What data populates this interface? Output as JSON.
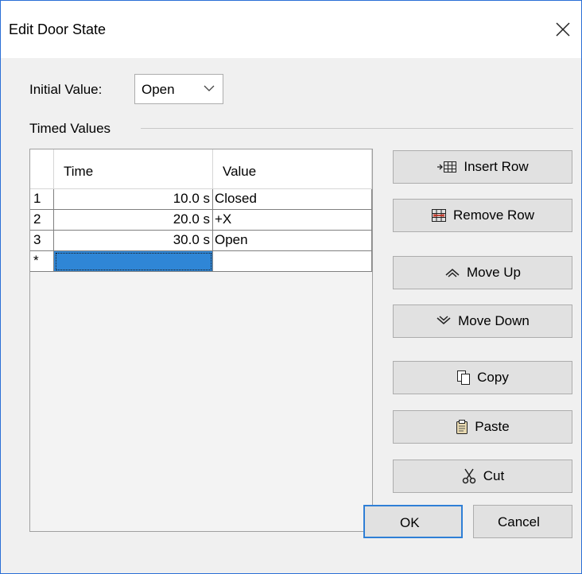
{
  "dialog": {
    "title": "Edit Door State",
    "close_icon": "close-icon"
  },
  "initial_value": {
    "label": "Initial Value:",
    "selected": "Open",
    "dropdown_icon": "chevron-down-icon"
  },
  "timed_values": {
    "group_label": "Timed Values",
    "columns": {
      "time": "Time",
      "value": "Value"
    },
    "rows": [
      {
        "num": "1",
        "time": "10.0 s",
        "value": "Closed"
      },
      {
        "num": "2",
        "time": "20.0 s",
        "value": "+X"
      },
      {
        "num": "3",
        "time": "30.0 s",
        "value": "Open"
      },
      {
        "num": "*",
        "time": "",
        "value": ""
      }
    ],
    "selection_color": "#2f86d6"
  },
  "buttons": {
    "insert_row": "Insert Row",
    "remove_row": "Remove Row",
    "move_up": "Move Up",
    "move_down": "Move Down",
    "copy": "Copy",
    "paste": "Paste",
    "cut": "Cut",
    "ok": "OK",
    "cancel": "Cancel"
  },
  "icons": [
    "insert-row-icon",
    "remove-row-icon",
    "move-up-icon",
    "move-down-icon",
    "copy-icon",
    "paste-icon",
    "cut-icon"
  ],
  "colors": {
    "window_border": "#2b6fd6",
    "ok_border": "#2f7fd6"
  }
}
